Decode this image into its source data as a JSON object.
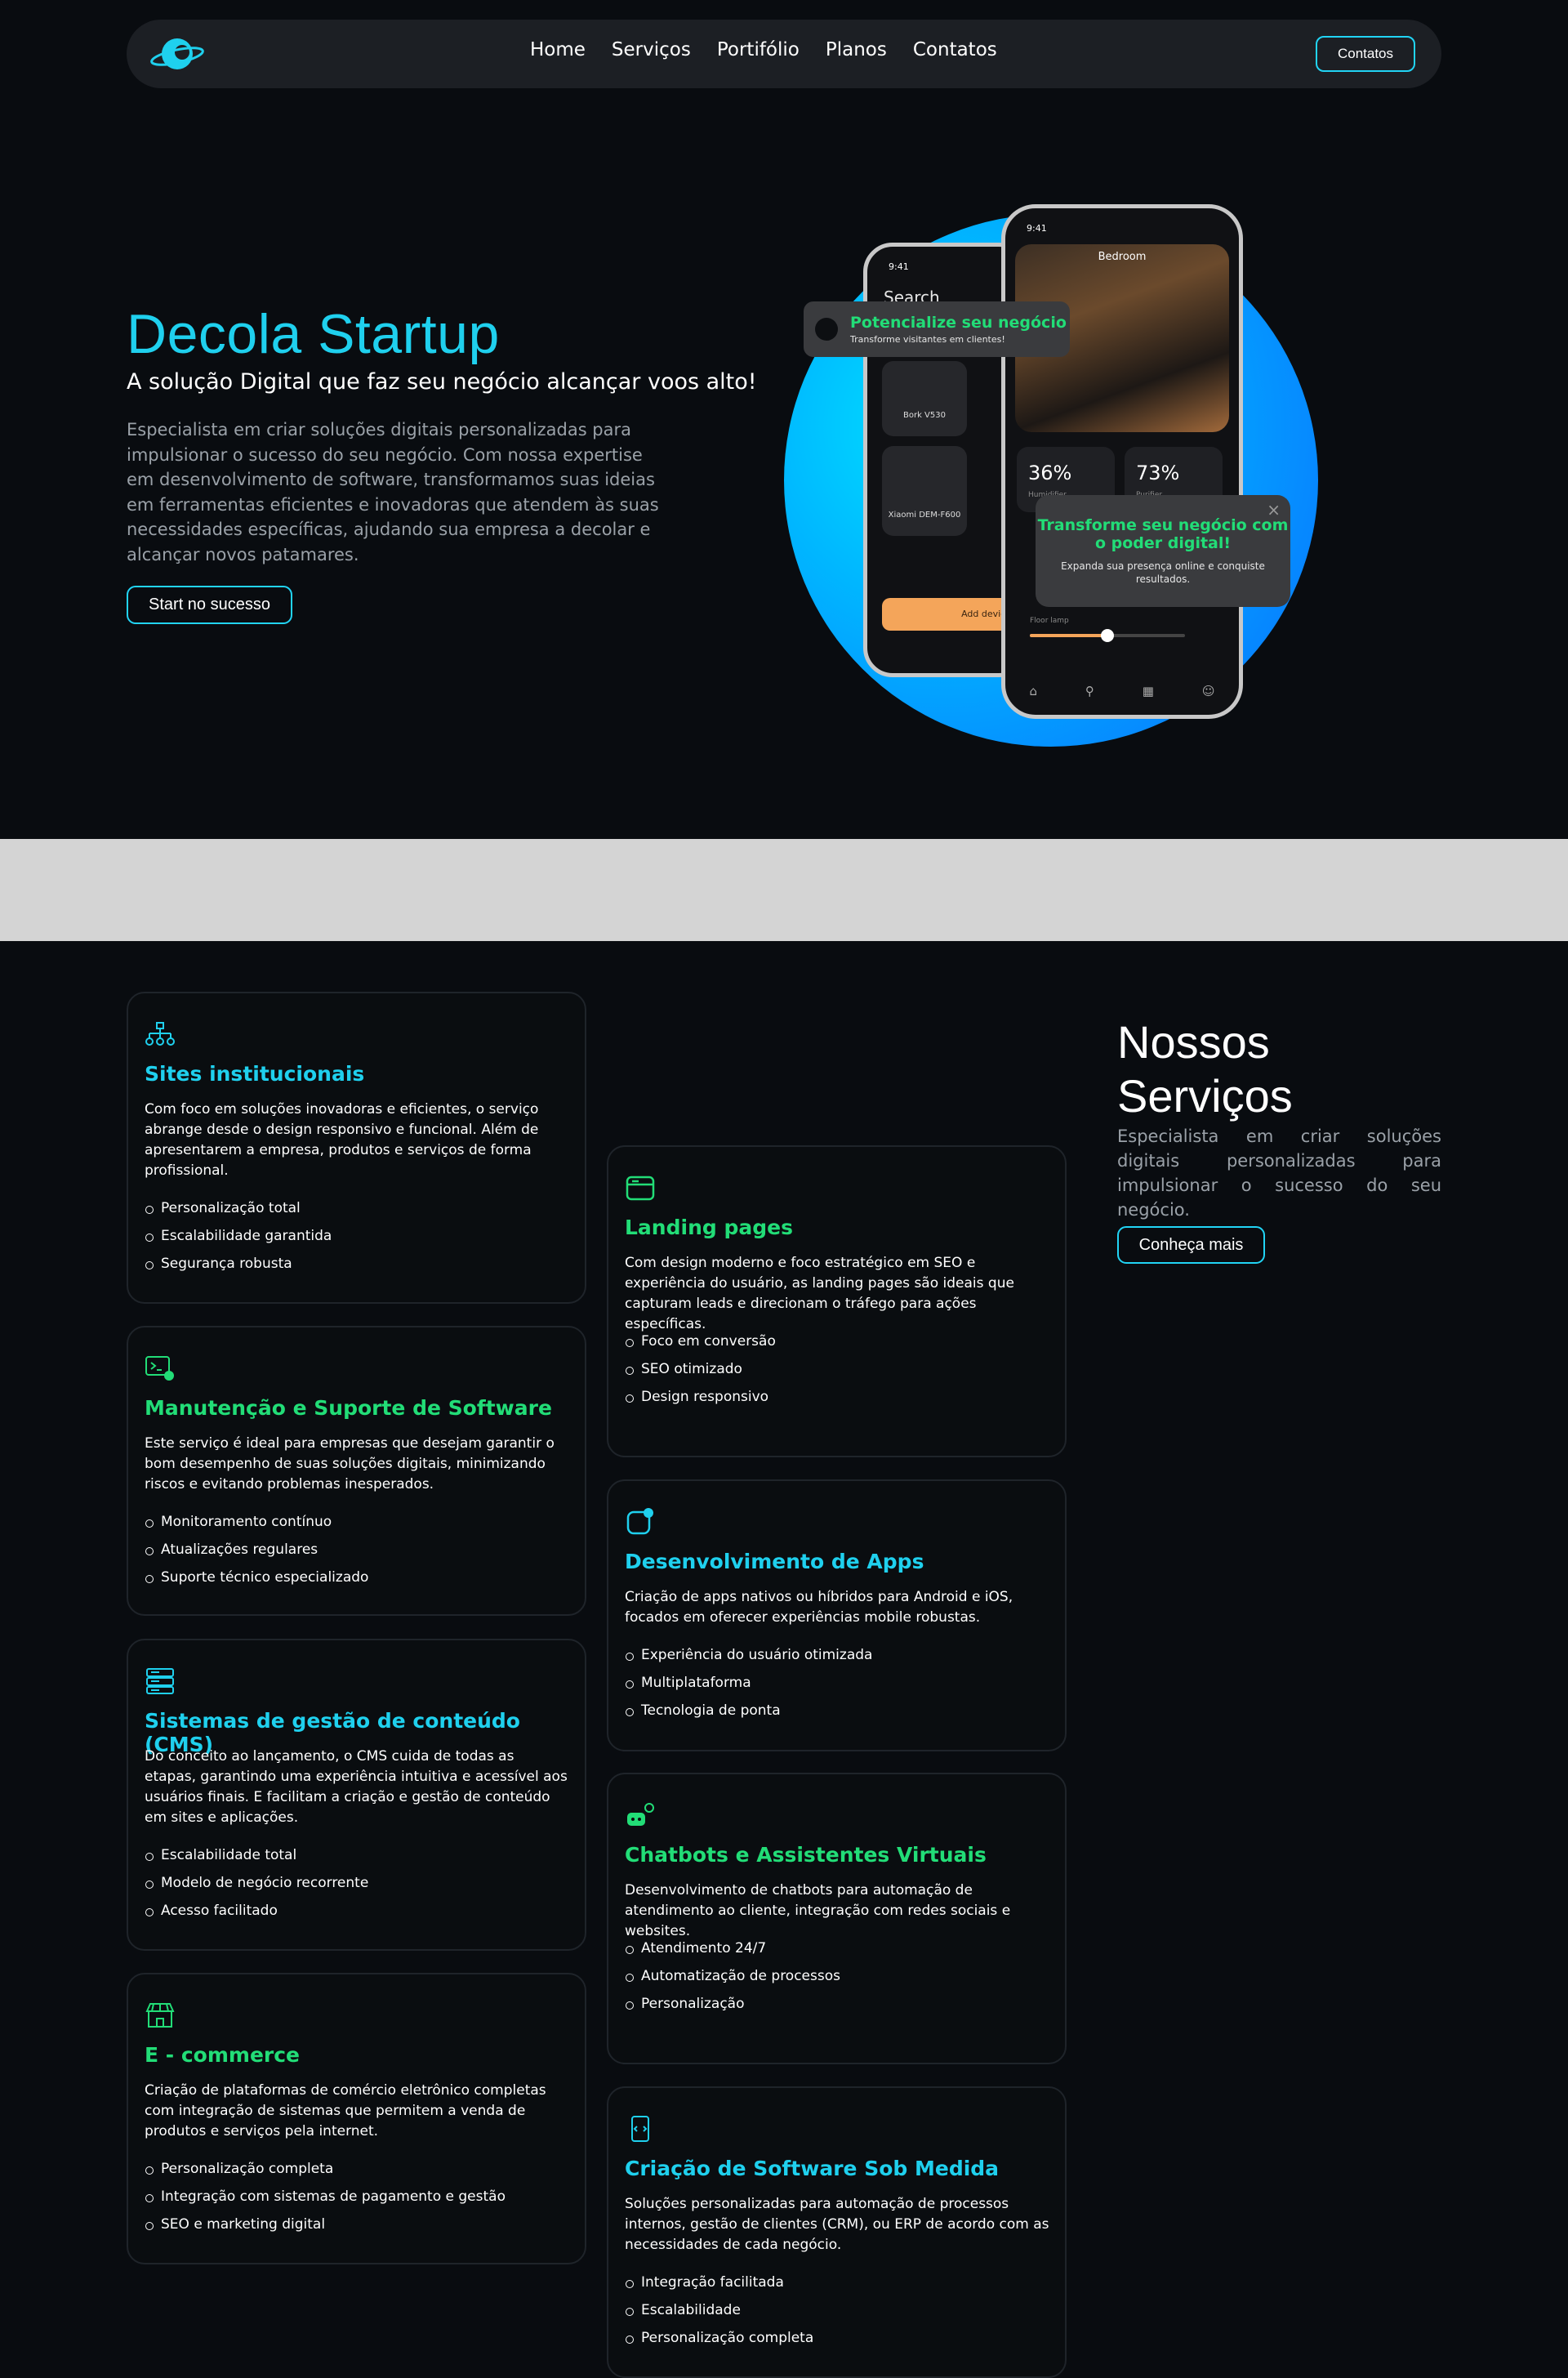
{
  "nav": {
    "logo_icon": "rocket-planet-logo",
    "links": [
      "Home",
      "Serviços",
      "Portifólio",
      "Planos",
      "Contatos"
    ],
    "cta_label": "Contatos"
  },
  "hero": {
    "title": "Decola Startup",
    "subtitle": "A solução Digital que faz seu negócio alcançar voos alto!",
    "description": "Especialista em criar soluções digitais personalizadas para impulsionar o sucesso do seu negócio. Com nossa expertise em desenvolvimento de software, transformamos suas ideias em ferramentas eficientes e inovadoras que atendem às suas necessidades específicas, ajudando sua empresa a decolar e alcançar novos patamares.",
    "button_label": "Start no sucesso",
    "accent_color": "#1fd0ee",
    "green_color": "#22dd77"
  },
  "mockup": {
    "back_phone": {
      "time": "9:41",
      "search_label": "Search",
      "devices": [
        "Bork V530",
        "Xiaomi DEM-F600"
      ],
      "add_device_label": "Add device"
    },
    "front_phone": {
      "time": "9:41",
      "room": "Bedroom",
      "humidity": "36%",
      "purifier": "73%",
      "humidity_label": "Humidifier",
      "purifier_label": "Purifier",
      "lamp_label": "Floor lamp",
      "lamp_level": 0.5
    },
    "popup_top": {
      "title": "Potencialize seu negócio",
      "text": "Transforme visitantes em clientes!"
    },
    "popup_bottom": {
      "title": "Transforme seu negócio com o poder digital!",
      "text": "Expanda sua presença online e conquiste resultados.",
      "close_icon": "close-icon"
    }
  },
  "services": {
    "title_line1": "Nossos",
    "title_line2": "Serviços",
    "description": "Especialista em criar soluções digitais personalizadas para impulsionar o sucesso do seu negócio.",
    "button_label": "Conheça mais",
    "cards": [
      {
        "icon": "sitemap-icon",
        "title": "Sites institucionais",
        "description": "Com foco em soluções inovadoras e eficientes, o serviço abrange desde o design responsivo e funcional. Além de apresentarem a empresa, produtos e serviços de forma profissional.",
        "items": [
          "Personalização total",
          "Escalabilidade garantida",
          "Segurança robusta"
        ]
      },
      {
        "icon": "terminal-gear-icon",
        "title": "Manutenção e Suporte de Software",
        "description": "Este serviço é ideal para empresas que desejam garantir o bom desempenho de suas soluções digitais, minimizando riscos e evitando problemas inesperados.",
        "items": [
          "Monitoramento contínuo",
          "Atualizações regulares",
          "Suporte técnico especializado"
        ]
      },
      {
        "icon": "server-icon",
        "title": "Sistemas de gestão de conteúdo (CMS)",
        "description": "Do conceito ao lançamento, o CMS cuida de todas as etapas, garantindo uma experiência intuitiva e acessível aos usuários finais. E facilitam a criação e gestão de conteúdo em sites e aplicações.",
        "items": [
          "Escalabilidade total",
          "Modelo de negócio recorrente",
          "Acesso facilitado"
        ]
      },
      {
        "icon": "storefront-icon",
        "title": "E - commerce",
        "description": "Criação de plataformas de comércio eletrônico completas com integração de sistemas que permitem a venda de produtos e serviços pela internet.",
        "items": [
          "Personalização completa",
          "Integração com sistemas de pagamento e gestão",
          "SEO e marketing digital"
        ]
      },
      {
        "icon": "browser-window-icon",
        "title": "Landing pages",
        "description": "Com design moderno e foco estratégico em SEO e experiência do usuário, as landing pages são ideais que capturam leads e direcionam o tráfego para ações específicas.",
        "items": [
          "Foco em conversão",
          "SEO otimizado",
          "Design responsivo"
        ]
      },
      {
        "icon": "app-notification-icon",
        "title": "Desenvolvimento de Apps",
        "description": "Criação de apps nativos ou híbridos para Android e iOS, focados em oferecer experiências mobile robustas.",
        "items": [
          "Experiência do usuário otimizada",
          "Multiplataforma",
          "Tecnologia de ponta"
        ]
      },
      {
        "icon": "chatbot-icon",
        "title": "Chatbots e Assistentes Virtuais",
        "description": "Desenvolvimento de chatbots para automação de atendimento ao cliente, integração com redes sociais e websites.",
        "items": [
          "Atendimento 24/7",
          "Automatização de processos",
          "Personalização"
        ]
      },
      {
        "icon": "mobile-code-icon",
        "title": "Criação de Software Sob Medida",
        "description": "Soluções personalizadas para automação de processos internos, gestão de clientes (CRM), ou ERP de acordo com as necessidades de cada negócio.",
        "items": [
          "Integração facilitada",
          "Escalabilidade",
          "Personalização completa"
        ]
      }
    ]
  }
}
